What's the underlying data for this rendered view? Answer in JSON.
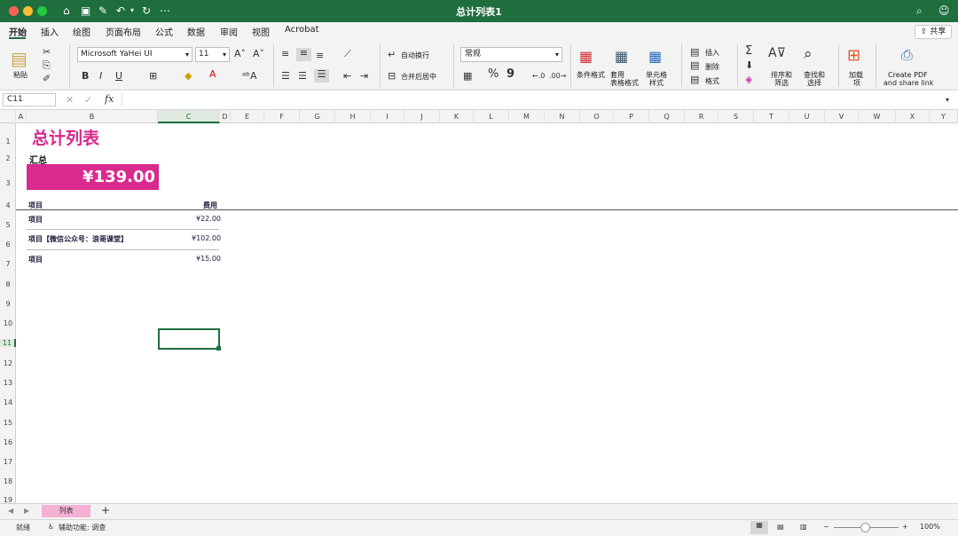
{
  "window": {
    "title": "总计列表1"
  },
  "titlebar": {
    "more": "⋯"
  },
  "tabs": [
    "开始",
    "插入",
    "绘图",
    "页面布局",
    "公式",
    "数据",
    "审阅",
    "视图",
    "Acrobat"
  ],
  "share_label": "共享",
  "ribbon": {
    "paste": "粘贴",
    "font_name": "Microsoft YaHei UI",
    "font_size": "11",
    "bold": "B",
    "italic": "I",
    "underline": "U",
    "wrap_text": "自动换行",
    "merge_center": "合并后居中",
    "number_format": "常规",
    "percent": "%",
    "comma": "9",
    "cond_format": "条件格式",
    "table_format": [
      "套用",
      "表格格式"
    ],
    "cell_style": [
      "单元格",
      "样式"
    ],
    "insert": "插入",
    "delete": "删除",
    "format": "格式",
    "sort_filter": [
      "排序和",
      "筛选"
    ],
    "find_select": [
      "查找和",
      "选择"
    ],
    "addins": [
      "加载",
      "项"
    ],
    "create_pdf": [
      "Create PDF",
      "and share link"
    ]
  },
  "formula_bar": {
    "name_box": "C11",
    "fx": "fx",
    "cancel": "✕",
    "confirm": "✓"
  },
  "columns": [
    "A",
    "B",
    "C",
    "D",
    "E",
    "F",
    "G",
    "H",
    "I",
    "J",
    "K",
    "L",
    "M",
    "N",
    "O",
    "P",
    "Q",
    "R",
    "S",
    "T",
    "U",
    "V",
    "W",
    "X",
    "Y"
  ],
  "rows": [
    "1",
    "2",
    "3",
    "4",
    "5",
    "6",
    "7",
    "8",
    "9",
    "10",
    "11",
    "12",
    "13",
    "14",
    "15",
    "16",
    "17",
    "18",
    "19"
  ],
  "sheet": {
    "title": "总计列表",
    "summary_label": "汇总",
    "total": "¥139.00",
    "header_item": "项目",
    "header_cost": "费用",
    "items": [
      {
        "name": "项目",
        "cost": "¥22.00"
      },
      {
        "name": "项目【微信公众号：浪哥课堂】",
        "cost": "¥102.00"
      },
      {
        "name": "项目",
        "cost": "¥15.00"
      }
    ]
  },
  "sheet_tabs": {
    "active": "列表",
    "add": "+"
  },
  "status": {
    "ready": "就绪",
    "accessibility": "辅助功能: 调查",
    "zoom": "100%"
  },
  "colors": {
    "brand": "#1e6e3e",
    "accent": "#d92a8e",
    "tab": "#f3b2d4"
  }
}
